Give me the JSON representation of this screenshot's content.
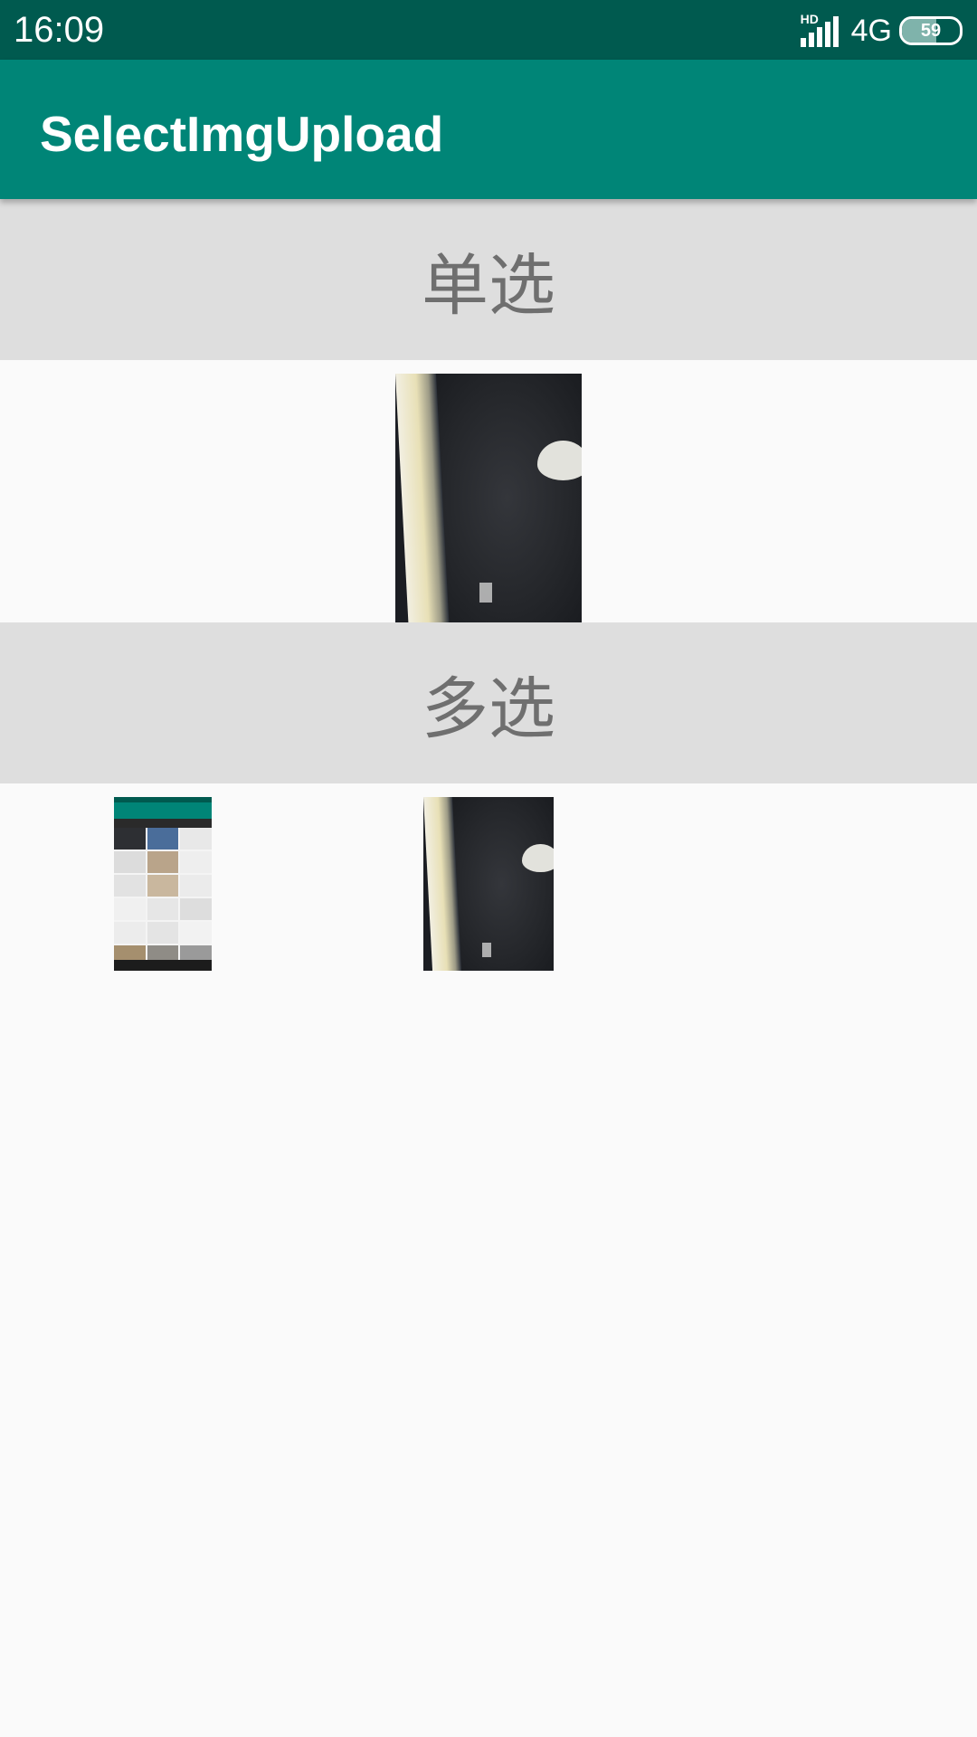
{
  "status_bar": {
    "time": "16:09",
    "network_badge": "HD",
    "network_type": "4G",
    "battery": "59",
    "icons": [
      "signal-icon",
      "battery-icon"
    ]
  },
  "app_bar": {
    "title": "SelectImgUpload",
    "color": "#008577"
  },
  "sections": {
    "single": {
      "label": "单选",
      "images": [
        "photo-thumbnail"
      ]
    },
    "multi": {
      "label": "多选",
      "images": [
        "screenshot-thumbnail",
        "photo-thumbnail"
      ]
    }
  },
  "colors": {
    "status_bar": "#005a4f",
    "app_bar": "#008577",
    "section_header_bg": "#dedede",
    "section_label": "#6f6f6f",
    "background": "#fafafa"
  }
}
